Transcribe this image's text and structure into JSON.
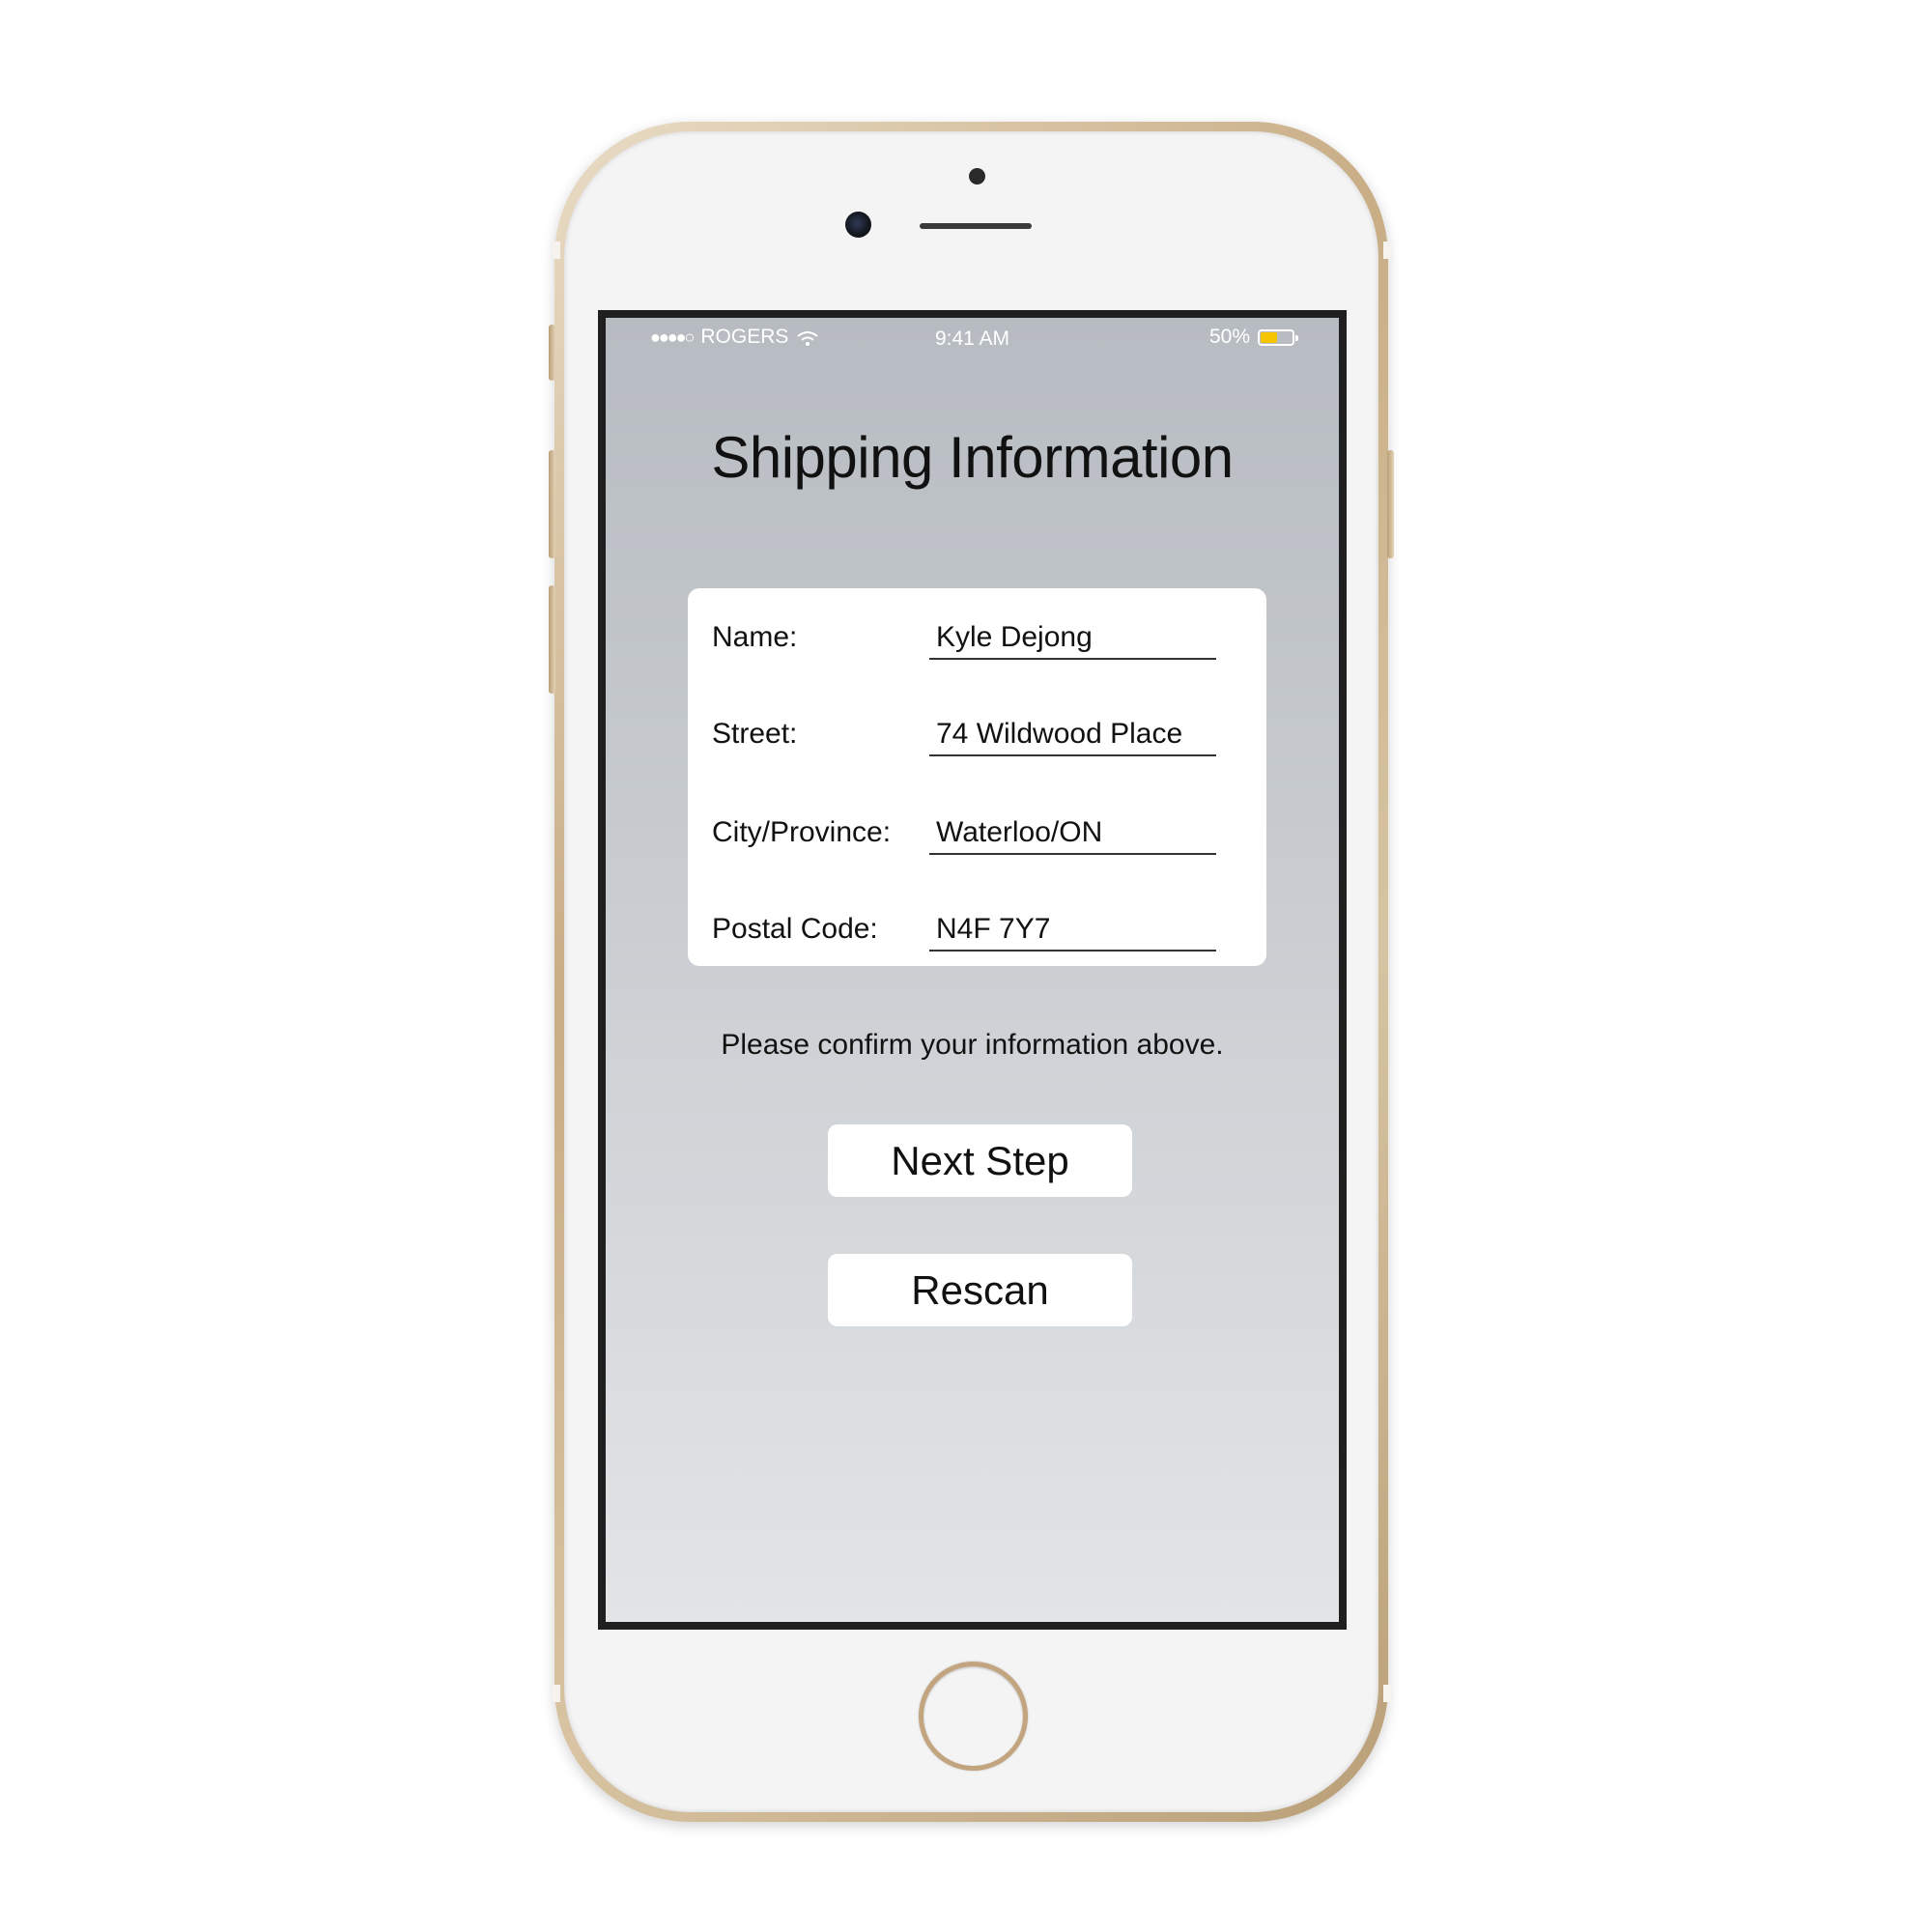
{
  "status_bar": {
    "signal": "●●●●○",
    "carrier": "ROGERS",
    "time": "9:41 AM",
    "battery_percent_label": "50%",
    "battery_level": 0.5
  },
  "page": {
    "title": "Shipping Information",
    "confirm_message": "Please confirm your information above."
  },
  "form": {
    "fields": [
      {
        "label": "Name:",
        "value": "Kyle Dejong"
      },
      {
        "label": "Street:",
        "value": "74 Wildwood Place"
      },
      {
        "label": "City/Province:",
        "value": "Waterloo/ON"
      },
      {
        "label": "Postal Code:",
        "value": "N4F 7Y7"
      }
    ]
  },
  "actions": {
    "next_label": "Next Step",
    "rescan_label": "Rescan"
  },
  "colors": {
    "battery": "#f5c400",
    "phone_gold": "#c8ad85"
  }
}
